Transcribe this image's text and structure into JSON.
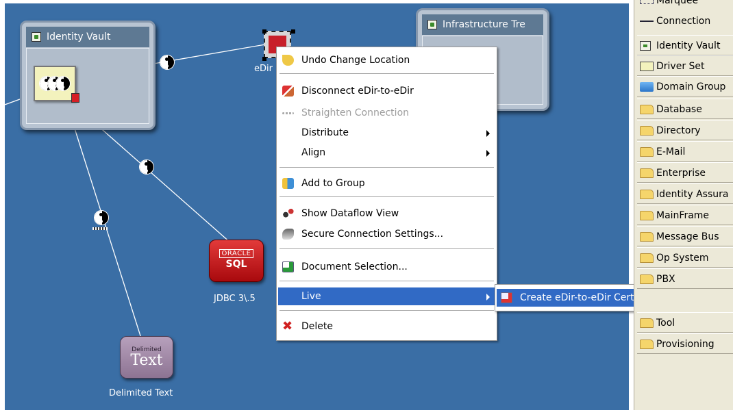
{
  "canvas": {
    "identity_vault_group": {
      "title": "Identity Vault"
    },
    "infrastructure_group": {
      "title": "Infrastructure Tre"
    },
    "edir_node": {
      "label": "eDir"
    },
    "oracle_node": {
      "logo_top": "ORACLE",
      "logo_bottom": "SQL",
      "label": "JDBC 3\\.5"
    },
    "delimited_node": {
      "logo_top": "Delimited",
      "logo_bottom": "Text",
      "label": "Delimited Text"
    }
  },
  "context_menu": {
    "items": [
      {
        "label": "Undo Change Location",
        "icon": "undo-icon"
      },
      {
        "label": "Disconnect eDir-to-eDir",
        "icon": "disconnect-icon"
      },
      {
        "label": "Straighten Connection",
        "icon": "straighten-icon",
        "disabled": true
      },
      {
        "label": "Distribute",
        "submenu": true
      },
      {
        "label": "Align",
        "submenu": true
      },
      {
        "label": "Add to Group",
        "icon": "add-to-group-icon"
      },
      {
        "label": "Show Dataflow View",
        "icon": "dataflow-icon"
      },
      {
        "label": "Secure Connection Settings...",
        "icon": "secure-connection-icon"
      },
      {
        "label": "Document Selection...",
        "icon": "document-icon"
      },
      {
        "label": "Live",
        "submenu": true,
        "highlighted": true
      },
      {
        "label": "Delete",
        "icon": "delete-icon"
      }
    ]
  },
  "submenu": {
    "items": [
      {
        "label": "Create eDir-to-eDir Certificates...",
        "icon": "certificate-icon",
        "highlighted": true
      }
    ]
  },
  "palette": {
    "items": [
      {
        "label": "Marquee",
        "icon": "marquee-icon"
      },
      {
        "label": "Connection",
        "icon": "connection-icon"
      },
      {
        "label": "Identity Vault",
        "icon": "identity-vault-icon"
      },
      {
        "label": "Driver Set",
        "icon": "driver-set-icon"
      },
      {
        "label": "Domain Group",
        "icon": "domain-group-icon"
      },
      {
        "label": "Database",
        "icon": "folder-icon"
      },
      {
        "label": "Directory",
        "icon": "folder-icon"
      },
      {
        "label": "E-Mail",
        "icon": "folder-icon"
      },
      {
        "label": "Enterprise",
        "icon": "folder-icon"
      },
      {
        "label": "Identity Assura",
        "icon": "folder-icon"
      },
      {
        "label": "MainFrame",
        "icon": "folder-icon"
      },
      {
        "label": "Message Bus",
        "icon": "folder-icon"
      },
      {
        "label": "Op System",
        "icon": "folder-icon"
      },
      {
        "label": "PBX",
        "icon": "folder-icon"
      },
      {
        "label": "Tool",
        "icon": "folder-icon"
      },
      {
        "label": "Provisioning",
        "icon": "folder-icon"
      }
    ]
  },
  "colors": {
    "canvas": "#3a6ea5",
    "selection": "#316ac5",
    "palette": "#ece9d8"
  }
}
